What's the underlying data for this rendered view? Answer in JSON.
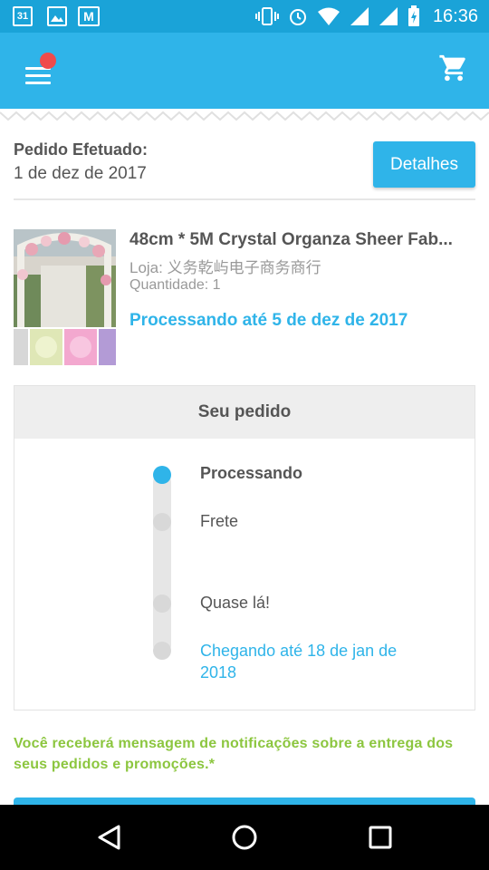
{
  "status_bar": {
    "calendar_day": "31",
    "time": "16:36",
    "left_icons": [
      "calendar-icon",
      "gallery-icon",
      "gmail-icon"
    ],
    "right_icons": [
      "vibrate-icon",
      "alarm-icon",
      "wifi-icon",
      "signal-icon",
      "signal-icon",
      "battery-charging-icon"
    ]
  },
  "header": {
    "menu_icon": "hamburger-icon",
    "notification_badge": "red-dot",
    "cart_icon": "cart-icon",
    "background_color": "#2fb4e9"
  },
  "order": {
    "label": "Pedido Efetuado:",
    "date": "1 de dez de 2017",
    "details_button": "Detalhes"
  },
  "product": {
    "title": "48cm * 5M Crystal Organza Sheer Fab...",
    "store": "Loja: 义务乾屿电子商务商行",
    "quantity": "Quantidade: 1",
    "status": "Processando até 5 de dez de 2017"
  },
  "tracking": {
    "title": "Seu pedido",
    "steps": [
      {
        "label": "Processando",
        "active": true
      },
      {
        "label": "Frete",
        "active": false
      },
      {
        "label": "Quase lá!",
        "active": false
      },
      {
        "label": "Chegando até 18 de jan de 2018",
        "active": false
      }
    ]
  },
  "notice": "Você receberá mensagem de notificações sobre a entrega dos seus pedidos e promoções.*",
  "colors": {
    "accent": "#2fb4e9",
    "status_bar": "#1aa3d8",
    "notice_green": "#8cc63f",
    "badge_red": "#ef4b4b"
  },
  "nav_bar": {
    "buttons": [
      "back-icon",
      "home-icon",
      "recents-icon"
    ]
  }
}
